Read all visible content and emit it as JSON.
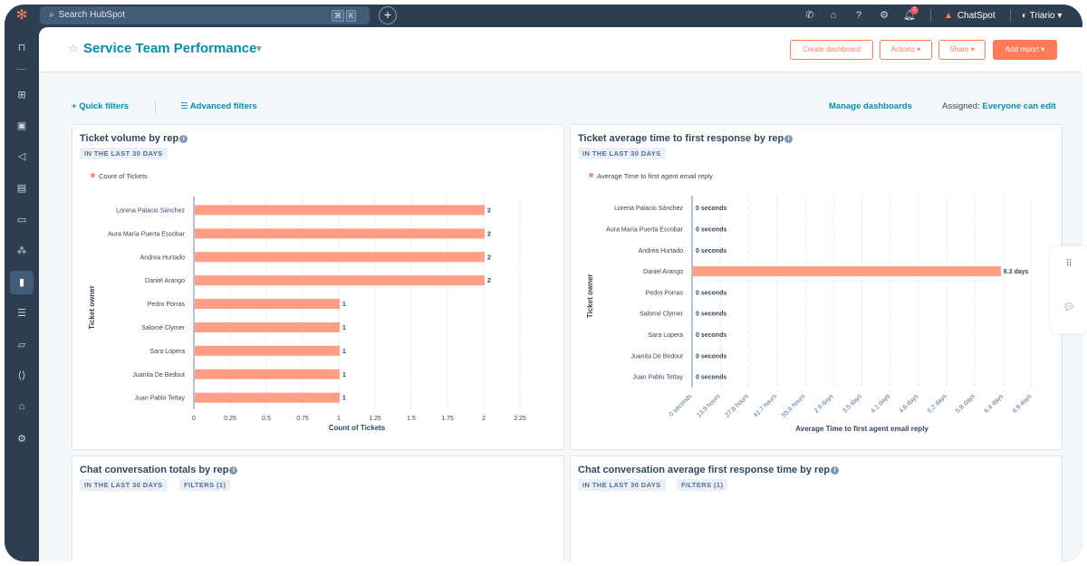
{
  "topnav": {
    "search_placeholder": "Search HubSpot",
    "search_shortcut": [
      "⌘",
      "K"
    ],
    "notification_count": "2",
    "chatspot_label": "ChatSpot",
    "account_name": "Triario",
    "icons": [
      "phone-icon",
      "marketplace-icon",
      "help-icon",
      "settings-icon",
      "notifications-icon"
    ]
  },
  "sidebar": {
    "items": [
      {
        "name": "bookmarks",
        "glyph": "⊓"
      },
      {
        "name": "workspaces",
        "glyph": "⊞"
      },
      {
        "name": "contacts",
        "glyph": "▣"
      },
      {
        "name": "marketing",
        "glyph": "◁"
      },
      {
        "name": "content",
        "glyph": "▤"
      },
      {
        "name": "commerce",
        "glyph": "▭"
      },
      {
        "name": "automation",
        "glyph": "⁂"
      },
      {
        "name": "reporting",
        "glyph": "▮",
        "active": true
      },
      {
        "name": "data-management",
        "glyph": "☰"
      },
      {
        "name": "library",
        "glyph": "▱"
      },
      {
        "name": "development",
        "glyph": "⟨⟩"
      },
      {
        "name": "app-marketplace",
        "glyph": "⌂"
      },
      {
        "name": "settings",
        "glyph": "⚙"
      }
    ]
  },
  "header": {
    "title": "Service Team Performance",
    "buttons": {
      "create_dashboard": "Create dashboard",
      "actions": "Actions ▾",
      "share": "Share ▾",
      "add_report": "Add report ▾"
    }
  },
  "filters": {
    "quick_filters": "Quick filters",
    "advanced_filters": "Advanced filters",
    "manage_dashboards": "Manage dashboards",
    "assigned_label": "Assigned:",
    "assigned_value": "Everyone can edit"
  },
  "colors": {
    "bar": "#ff9e85",
    "accent": "#ff7a59",
    "link": "#0091ae",
    "nav_bg": "#2d3e50"
  },
  "cards": [
    {
      "title": "Ticket volume by rep",
      "tags": [
        "IN THE LAST 30 DAYS"
      ]
    },
    {
      "title": "Ticket average time to first response by rep",
      "tags": [
        "IN THE LAST 30 DAYS"
      ]
    },
    {
      "title": "Chat conversation totals by rep",
      "tags": [
        "IN THE LAST 30 DAYS",
        "FILTERS (1)"
      ]
    },
    {
      "title": "Chat conversation average first response time by rep",
      "tags": [
        "IN THE LAST 30 DAYS",
        "FILTERS (1)"
      ]
    }
  ],
  "chart_data": [
    {
      "type": "bar",
      "orientation": "horizontal",
      "title": "Ticket volume by rep",
      "legend": "Count of Tickets",
      "xlabel": "Count of Tickets",
      "ylabel": "Ticket owner",
      "categories": [
        "Lorena Palacio Sánchez",
        "Aura María Puerta Escobar",
        "Andrea Hurtado",
        "Daniel Arango",
        "Pedro Porras",
        "Salomé Clymer",
        "Sara Lopera",
        "Juanita De Bedout",
        "Juan Pablo Tettay"
      ],
      "values": [
        2,
        2,
        2,
        2,
        1,
        1,
        1,
        1,
        1
      ],
      "value_labels": [
        "2",
        "2",
        "2",
        "2",
        "1",
        "1",
        "1",
        "1",
        "1"
      ],
      "xticks": [
        "0",
        "0.25",
        "0.5",
        "0.75",
        "1",
        "1.25",
        "1.5",
        "1.75",
        "2",
        "2.25"
      ],
      "xlim": [
        0,
        2.25
      ],
      "grid": true
    },
    {
      "type": "bar",
      "orientation": "horizontal",
      "title": "Ticket average time to first response by rep",
      "legend": "Average Time to first agent email reply",
      "xlabel": "Average Time to first agent email reply",
      "ylabel": "Ticket owner",
      "categories": [
        "Lorena Palacio Sánchez",
        "Aura María Puerta Escobar",
        "Andrea Hurtado",
        "Daniel Arango",
        "Pedro Porras",
        "Salomé Clymer",
        "Sara Lopera",
        "Juanita De Bedout",
        "Juan Pablo Tettay"
      ],
      "values_days": [
        0,
        0,
        0,
        6.3,
        0,
        0,
        0,
        0,
        0
      ],
      "value_labels": [
        "0 seconds",
        "0 seconds",
        "0 seconds",
        "6.3 days",
        "0 seconds",
        "0 seconds",
        "0 seconds",
        "0 seconds",
        "0 seconds"
      ],
      "xticks": [
        "0 seconds",
        "13.9 hours",
        "27.8 hours",
        "41.7 hours",
        "55.6 hours",
        "2.9 days",
        "3.5 days",
        "4.1 days",
        "4.6 days",
        "5.2 days",
        "5.8 days",
        "6.4 days",
        "6.9 days"
      ],
      "xlim_days": [
        0,
        6.95
      ],
      "grid": true
    }
  ]
}
